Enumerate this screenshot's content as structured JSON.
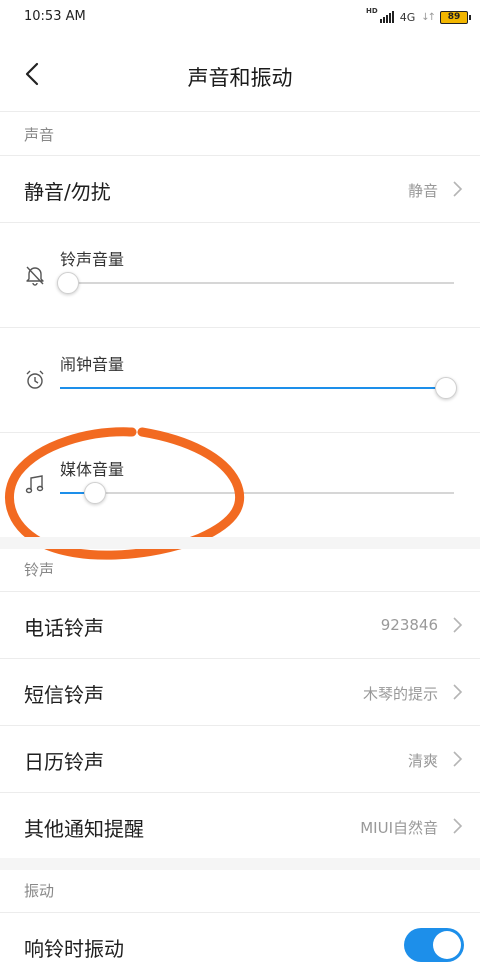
{
  "status_bar": {
    "time": "10:53 AM",
    "hd": "HD",
    "network": "4G",
    "battery": "89",
    "battery_color": "#f2b600"
  },
  "header": {
    "back_icon": "chevron-left-icon",
    "title": "声音和振动"
  },
  "sections": {
    "sound": {
      "label": "声音",
      "silent_row": {
        "title": "静音/勿扰",
        "value": "静音"
      },
      "sliders": [
        {
          "label": "铃声音量",
          "icon": "bell-off-icon",
          "level": 0.02
        },
        {
          "label": "闹钟音量",
          "icon": "alarm-clock-icon",
          "level": 0.98
        },
        {
          "label": "媒体音量",
          "icon": "music-note-icon",
          "level": 0.09
        }
      ]
    },
    "ringtone": {
      "label": "铃声",
      "rows": [
        {
          "title": "电话铃声",
          "value": "923846"
        },
        {
          "title": "短信铃声",
          "value": "木琴的提示"
        },
        {
          "title": "日历铃声",
          "value": "清爽"
        },
        {
          "title": "其他通知提醒",
          "value": "MIUI自然音"
        }
      ]
    },
    "vibration": {
      "label": "振动",
      "ring_vibrate": {
        "title": "响铃时振动",
        "enabled": true
      }
    }
  },
  "colors": {
    "accent": "#1d8fea",
    "annotation": "#f26a21"
  }
}
